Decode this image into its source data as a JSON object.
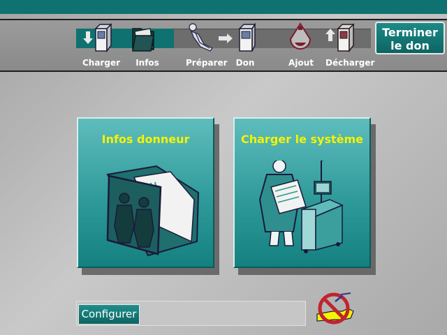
{
  "steps": [
    {
      "label": "Charger",
      "icon": "cartridge-load-icon",
      "done": true
    },
    {
      "label": "Infos",
      "icon": "folder-icon",
      "done": true
    },
    {
      "label": "Préparer",
      "icon": "donor-chair-icon",
      "done": false
    },
    {
      "label": "Don",
      "icon": "donation-machine-icon",
      "done": false
    },
    {
      "label": "Ajout",
      "icon": "solution-bag-icon",
      "done": false
    },
    {
      "label": "Décharger",
      "icon": "cartridge-unload-icon",
      "done": false
    }
  ],
  "end_button": {
    "line1": "Terminer",
    "line2": "le don"
  },
  "tiles": {
    "donor_info": {
      "title": "Infos donneur",
      "icon": "donor-folder-icon"
    },
    "load_system": {
      "title": "Charger le système",
      "icon": "operator-machine-icon"
    }
  },
  "config_button": {
    "label": "Configurer"
  },
  "status": {
    "icon": "no-donor-icon"
  },
  "colors": {
    "accent": "#0f7270",
    "tile": "#2b9797",
    "title_text": "#f4f400",
    "background": "#b8b8b8"
  }
}
